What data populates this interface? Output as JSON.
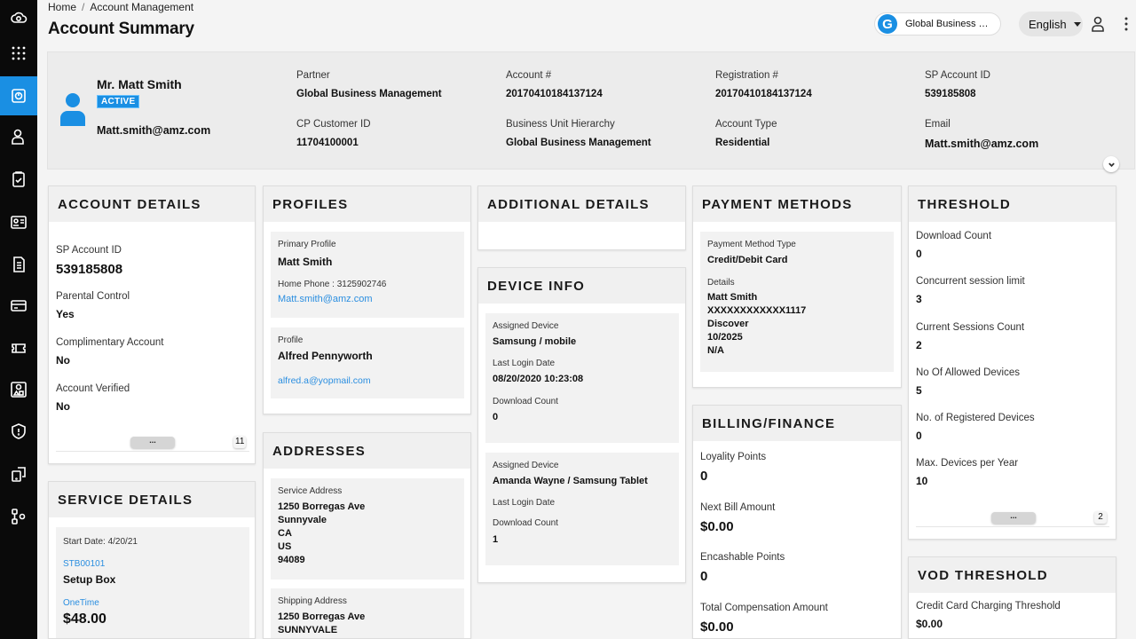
{
  "rail": {
    "items": [
      {
        "icon": "cloud-logo-icon"
      },
      {
        "icon": "grid-icon"
      },
      {
        "icon": "dashboard-icon",
        "active": true
      },
      {
        "icon": "user-icon"
      },
      {
        "icon": "clipboard-check-icon"
      },
      {
        "icon": "id-card-icon"
      },
      {
        "icon": "document-icon"
      },
      {
        "icon": "billing-card-icon"
      },
      {
        "icon": "ticket-icon"
      },
      {
        "icon": "account-shapes-icon"
      },
      {
        "icon": "shield-icon"
      },
      {
        "icon": "devices-icon"
      },
      {
        "icon": "workflow-icon"
      }
    ]
  },
  "breadcrumb": {
    "home": "Home",
    "separator": "/",
    "current": "Account Management"
  },
  "page_title": "Account Summary",
  "header": {
    "org_initial": "G",
    "org_name": "Global Business Management",
    "language": "English"
  },
  "summary": {
    "name": "Mr. Matt Smith",
    "status": "ACTIVE",
    "email": "Matt.smith@amz.com",
    "fields": [
      {
        "label": "Partner",
        "value": "Global Business Management"
      },
      {
        "label": "Account #",
        "value": "20170410184137124"
      },
      {
        "label": "Registration #",
        "value": "20170410184137124"
      },
      {
        "label": "SP Account ID",
        "value": "539185808"
      },
      {
        "label": "CP Customer ID",
        "value": "11704100001"
      },
      {
        "label": "Business Unit Hierarchy",
        "value": "Global Business Management"
      },
      {
        "label": "Account Type",
        "value": "Residential"
      },
      {
        "label": "Email",
        "value": "Matt.smith@amz.com"
      }
    ]
  },
  "account_details": {
    "title": "ACCOUNT DETAILS",
    "fields": [
      {
        "label": "SP Account ID",
        "value": "539185808"
      },
      {
        "label": "Parental Control",
        "value": "Yes"
      },
      {
        "label": "Complimentary Account",
        "value": "No"
      },
      {
        "label": "Account Verified",
        "value": "No"
      }
    ],
    "more": "...",
    "count": "11"
  },
  "service_details": {
    "title": "SERVICE DETAILS",
    "start_date": "Start Date: 4/20/21",
    "code": "STB00101",
    "name": "Setup Box",
    "charge_type": "OneTime",
    "price": "$48.00"
  },
  "profiles": {
    "title": "PROFILES",
    "items": [
      {
        "type": "Primary Profile",
        "name": "Matt Smith",
        "phone": "Home Phone : 3125902746",
        "email": "Matt.smith@amz.com"
      },
      {
        "type": "Profile",
        "name": "Alfred Pennyworth",
        "email": "alfred.a@yopmail.com"
      }
    ]
  },
  "addresses": {
    "title": "ADDRESSES",
    "items": [
      {
        "type": "Service Address",
        "lines": [
          "1250 Borregas Ave",
          "Sunnyvale",
          "CA",
          "US",
          "94089"
        ]
      },
      {
        "type": "Shipping Address",
        "lines": [
          "1250 Borregas Ave",
          "SUNNYVALE"
        ]
      }
    ]
  },
  "additional_details": {
    "title": "ADDITIONAL DETAILS"
  },
  "device_info": {
    "title": "DEVICE INFO",
    "items": [
      {
        "assigned_label": "Assigned Device",
        "device": "Samsung / mobile",
        "login_label": "Last Login Date",
        "login": "08/20/2020 10:23:08",
        "download_label": "Download Count",
        "download": "0"
      },
      {
        "assigned_label": "Assigned Device",
        "device": "Amanda Wayne / Samsung Tablet",
        "login_label": "Last Login Date",
        "login": "",
        "download_label": "Download Count",
        "download": "1"
      }
    ]
  },
  "payment_methods": {
    "title": "PAYMENT METHODS",
    "type_label": "Payment Method Type",
    "type": "Credit/Debit Card",
    "details_label": "Details",
    "details": [
      "Matt Smith",
      "XXXXXXXXXXXX1117",
      "Discover",
      "10/2025",
      "N/A"
    ]
  },
  "billing": {
    "title": "BILLING/FINANCE",
    "fields": [
      {
        "label": "Loyality Points",
        "value": "0"
      },
      {
        "label": "Next Bill Amount",
        "value": "$0.00"
      },
      {
        "label": "Encashable Points",
        "value": "0"
      },
      {
        "label": "Total Compensation Amount",
        "value": "$0.00"
      }
    ]
  },
  "threshold": {
    "title": "THRESHOLD",
    "fields": [
      {
        "label": "Download Count",
        "value": "0"
      },
      {
        "label": "Concurrent session limit",
        "value": "3"
      },
      {
        "label": "Current Sessions Count",
        "value": "2"
      },
      {
        "label": "No Of Allowed Devices",
        "value": "5"
      },
      {
        "label": "No. of Registered Devices",
        "value": "0"
      },
      {
        "label": "Max. Devices per Year",
        "value": "10"
      }
    ],
    "more": "...",
    "count": "2"
  },
  "vod_threshold": {
    "title": "VOD THRESHOLD",
    "label": "Credit Card Charging Threshold",
    "value": "$0.00"
  },
  "colors": {
    "accent": "#1a8fe3",
    "link": "#2a8ee0",
    "rail": "#0a0a0a"
  }
}
